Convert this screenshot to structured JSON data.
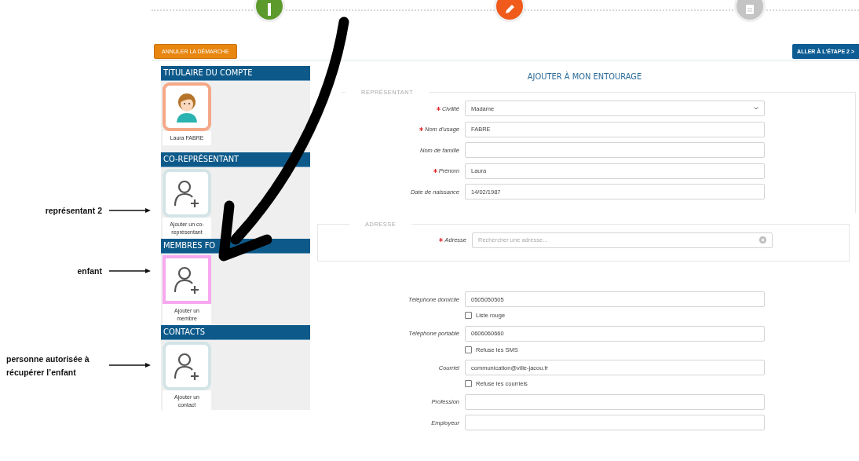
{
  "progress_steps": [
    {
      "kind": "done"
    },
    {
      "kind": "current"
    },
    {
      "kind": "pending"
    }
  ],
  "cancel_button": "ANNULER LA DÉMARCHE",
  "next_button": "ALLER À L'ÉTAPE 2 >",
  "sidebar": {
    "sections": [
      {
        "title": "TITULAIRE DU COMPTE",
        "card": {
          "kind": "person",
          "caption": "Laura FABRE",
          "highlighted": false
        }
      },
      {
        "title": "CO-REPRÉSENTANT",
        "card": {
          "kind": "add",
          "caption": "Ajouter un co-représentant",
          "highlighted": false
        }
      },
      {
        "title": "MEMBRES FO",
        "card": {
          "kind": "add",
          "caption": "Ajouter un membre",
          "highlighted": true
        }
      },
      {
        "title": "CONTACTS",
        "card": {
          "kind": "add",
          "caption": "Ajouter un contact",
          "highlighted": false
        }
      }
    ]
  },
  "form": {
    "title": "AJOUTER À MON ENTOURAGE",
    "representant": {
      "legend": "REPRÉSENTANT",
      "fields": [
        {
          "kind": "select",
          "label": "Civilité",
          "required": true,
          "value": "Madame"
        },
        {
          "kind": "text",
          "label": "Nom d'usage",
          "required": true,
          "value": "FABRE"
        },
        {
          "kind": "text",
          "label": "Nom de famille",
          "required": false
        },
        {
          "kind": "text",
          "label": "Prénom",
          "required": true,
          "value": "Laura"
        },
        {
          "kind": "text",
          "label": "Date de naissance",
          "required": false,
          "value": "14/02/1987"
        }
      ]
    },
    "address": {
      "legend": "ADRESSE",
      "fields": [
        {
          "kind": "search",
          "label": "Adresse",
          "required": true,
          "placeholder": "Rechercher une adresse..."
        }
      ]
    },
    "contact_fields": [
      {
        "kind": "text",
        "label": "Téléphone domicile",
        "value": "0505050505"
      },
      {
        "kind": "checkbox",
        "label": "Liste rouge",
        "checked": false
      },
      {
        "kind": "text",
        "label": "Téléphone portable",
        "value": "0606060660"
      },
      {
        "kind": "checkbox",
        "label": "Refuse les SMS",
        "checked": false
      },
      {
        "kind": "text",
        "label": "Courriel",
        "value": "communication@ville-jacou.fr"
      },
      {
        "kind": "checkbox",
        "label": "Refuse les courriels",
        "checked": false
      },
      {
        "kind": "text",
        "label": "Profession"
      },
      {
        "kind": "text",
        "label": "Employeur"
      }
    ]
  },
  "annotations": [
    {
      "text": "représentant 2"
    },
    {
      "text": "enfant"
    },
    {
      "text": "personne autorisée à récupérer l’enfant"
    }
  ]
}
